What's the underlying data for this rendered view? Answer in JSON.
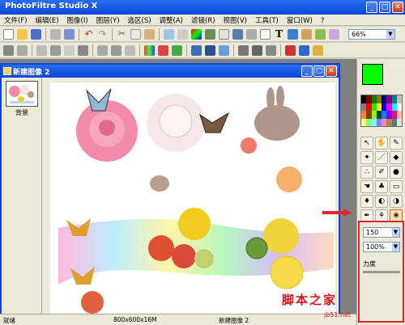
{
  "app": {
    "title": "PhotoFiltre Studio X",
    "accent": "#0a46d8"
  },
  "window_buttons": [
    "_",
    "□",
    "✕"
  ],
  "menu": [
    "文件(F)",
    "编辑(E)",
    "图像(I)",
    "图层(Y)",
    "选区(S)",
    "调整(A)",
    "滤镜(R)",
    "视图(V)",
    "工具(T)",
    "窗口(W)",
    "?"
  ],
  "toolbar": {
    "zoom_value": "66%"
  },
  "document": {
    "title": "新建图像 2",
    "layer_label": "背景"
  },
  "status": {
    "left": "就绪",
    "size": "800x600x16M",
    "name": "新建图像 2"
  },
  "palette": {
    "foreground_color": "#00ff00",
    "background_color": "#ffffff",
    "brush_size": "150",
    "opacity": "100%",
    "strength_label": "力度"
  },
  "watermark": {
    "main": "脚本之家",
    "sub": "jb51.net"
  }
}
